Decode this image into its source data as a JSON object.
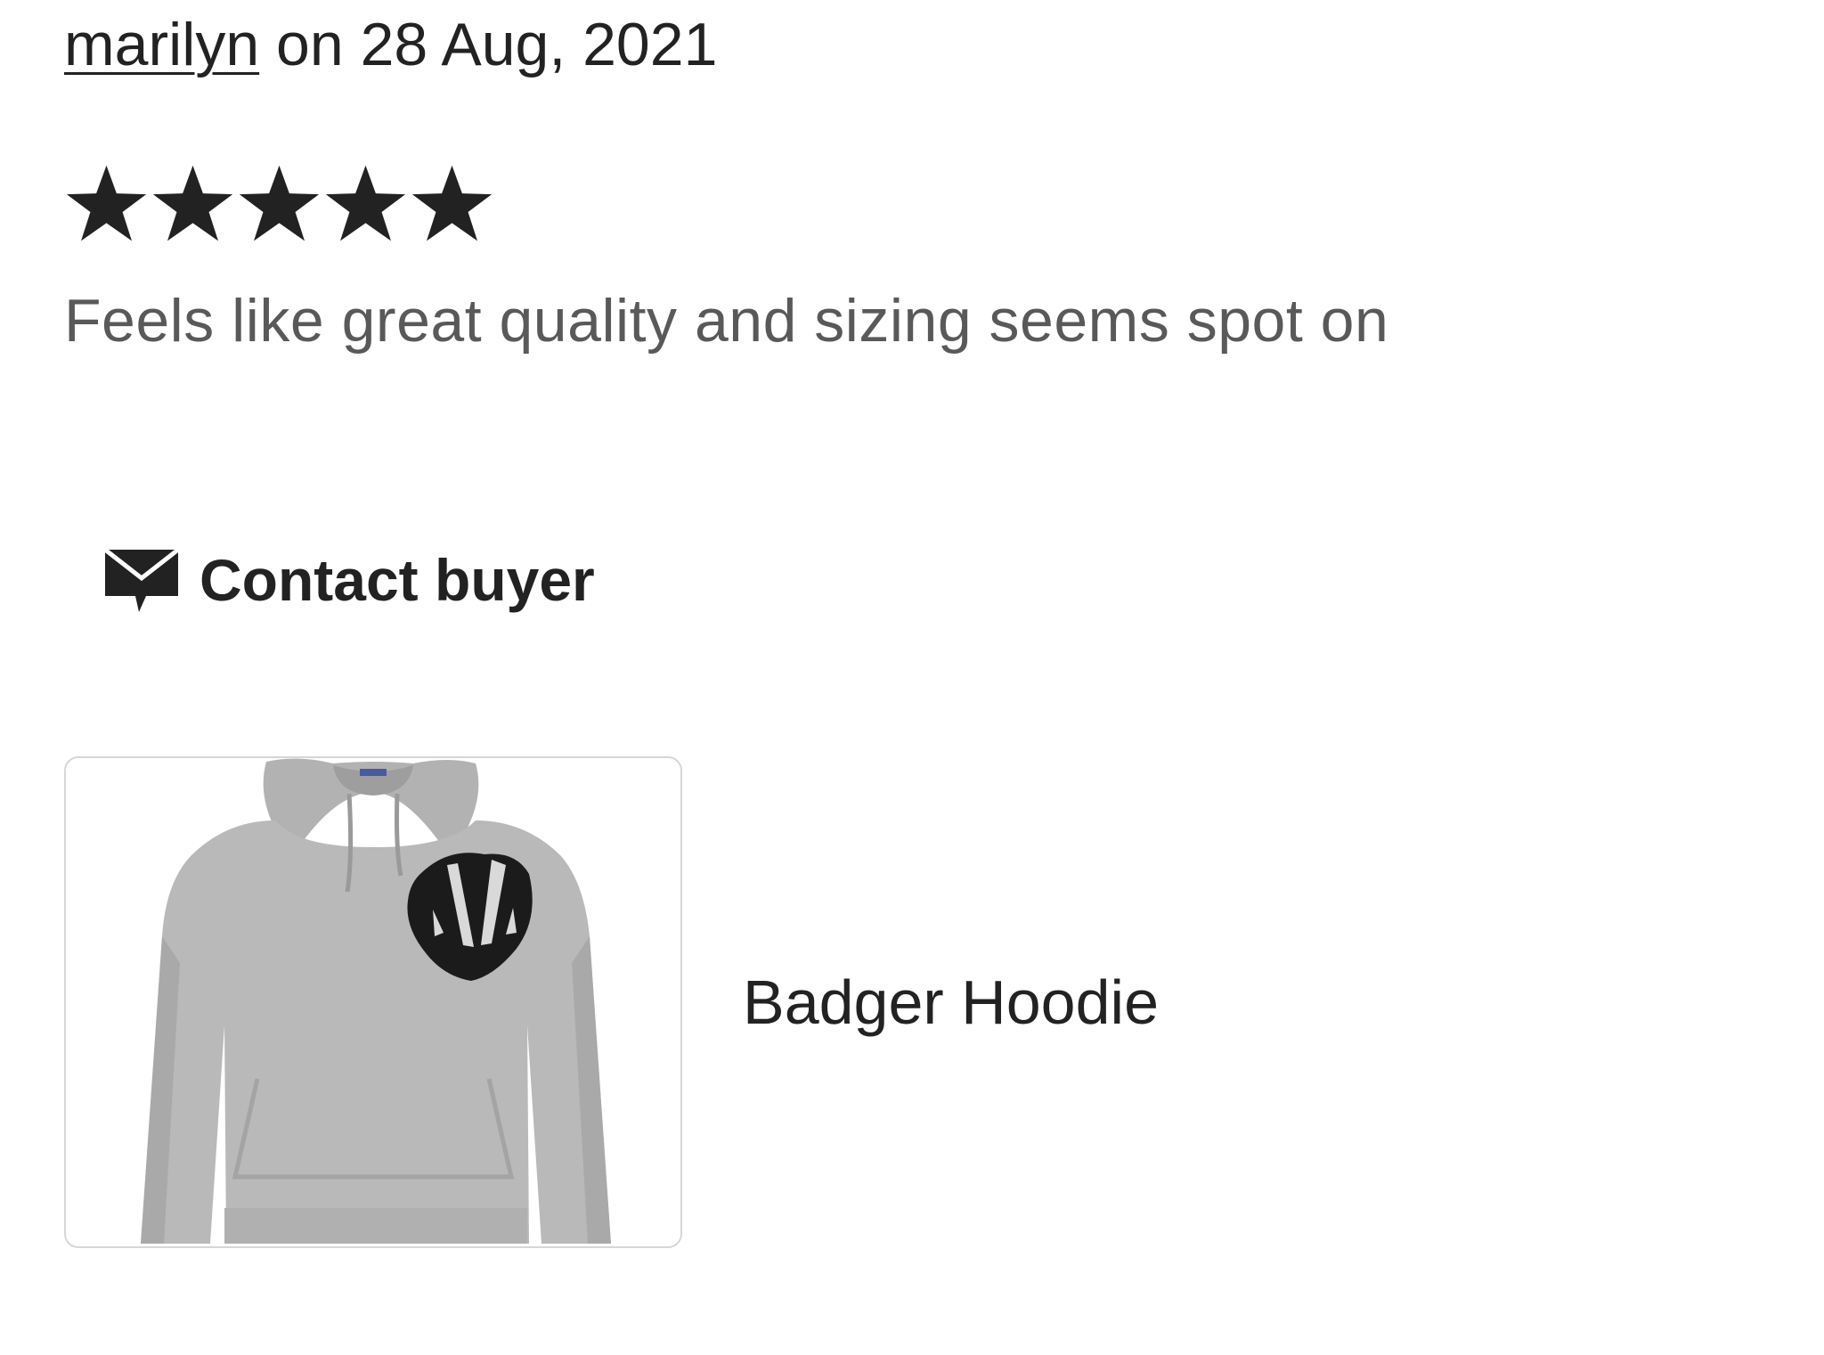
{
  "review": {
    "reviewer_name": "marilyn",
    "date_prefix": " on ",
    "date": "28 Aug, 2021",
    "rating": 5,
    "rating_max": 5,
    "text": "Feels like great quality and sizing seems spot on"
  },
  "contact": {
    "icon": "envelope-icon",
    "label": "Contact buyer"
  },
  "listing": {
    "image_icon": "hoodie-image",
    "title": "Badger Hoodie"
  },
  "colors": {
    "text_primary": "#222222",
    "text_secondary": "#595959",
    "star": "#222222",
    "thumb_border": "#d6d6d6",
    "hoodie": "#b9b9b9"
  }
}
